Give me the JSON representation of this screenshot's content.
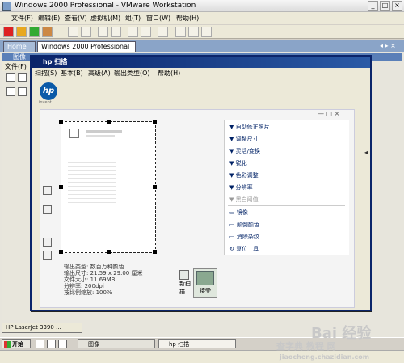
{
  "window": {
    "title": "Windows 2000 Professional - VMware Workstation"
  },
  "menu": [
    "文件(F)",
    "编辑(E)",
    "查看(V)",
    "虚拟机(M)",
    "组(T)",
    "窗口(W)",
    "帮助(H)"
  ],
  "tabs": {
    "home": "Home",
    "vm": "Windows 2000 Professional"
  },
  "guest_window": {
    "title": "图像",
    "menu": "文件(F)"
  },
  "dialog": {
    "title": "hp 扫描",
    "menu": [
      "扫描(S)",
      "基本(B)",
      "高级(A)",
      "输出类型(O)",
      "帮助(H)"
    ],
    "hp_tagline": "invent",
    "panel_controls": "— □ ×",
    "info": {
      "line1": "输出类型: 数百万种颜色",
      "line2": "输出尺寸: 21.59 x 29.00 厘米",
      "line3": "文件大小: 11.69MB",
      "line4": "分辨率: 200dpi",
      "line5": "按比例缩放: 100%"
    },
    "new_scan": "新扫描",
    "accept": "接受",
    "panel": {
      "auto": "自动修正照片",
      "size": "调整尺寸",
      "light": "灵活/变换",
      "sharpen": "锐化",
      "color": "色彩调整",
      "resolution": "分辨率",
      "bw": "黑白阈值",
      "mirror": "镜像",
      "invert": "颠倒颜色",
      "descreen": "消除杂纹",
      "reset": "复位工具"
    }
  },
  "taskbar": {
    "mini_task": "HP LaserJet 3390 ...",
    "start": "开始",
    "items": {
      "images": "图像",
      "scan": "hp 扫描"
    }
  },
  "watermark": {
    "brand": "Bai 经验",
    "site": "jiaocheng.chazidian.com",
    "sub": "查字典 教程 网"
  }
}
